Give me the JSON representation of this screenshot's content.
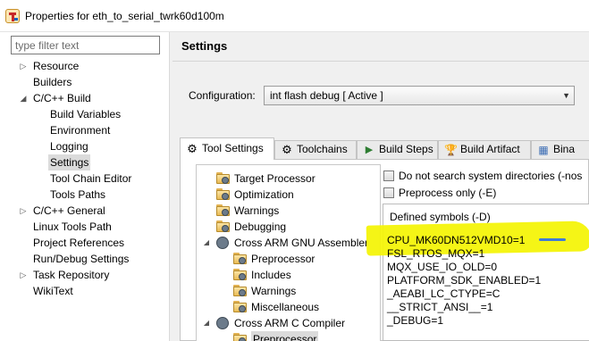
{
  "window": {
    "title": "Properties for eth_to_serial_twrk60d100m",
    "icon": "properties-icon"
  },
  "filter": {
    "placeholder": "type filter text",
    "value": ""
  },
  "nav_tree": [
    {
      "label": "Resource",
      "toggle": "▷"
    },
    {
      "label": "Builders",
      "toggle": ""
    },
    {
      "label": "C/C++ Build",
      "toggle": "◢"
    },
    {
      "label": "Build Variables",
      "toggle": ""
    },
    {
      "label": "Environment",
      "toggle": ""
    },
    {
      "label": "Logging",
      "toggle": ""
    },
    {
      "label": "Settings",
      "toggle": "",
      "selected": true
    },
    {
      "label": "Tool Chain Editor",
      "toggle": ""
    },
    {
      "label": "Tools Paths",
      "toggle": ""
    },
    {
      "label": "C/C++ General",
      "toggle": "▷"
    },
    {
      "label": "Linux Tools Path",
      "toggle": ""
    },
    {
      "label": "Project References",
      "toggle": ""
    },
    {
      "label": "Run/Debug Settings",
      "toggle": ""
    },
    {
      "label": "Task Repository",
      "toggle": "▷"
    },
    {
      "label": "WikiText",
      "toggle": ""
    }
  ],
  "settings": {
    "title": "Settings",
    "configuration_label": "Configuration:",
    "configuration_value": "int flash debug  [ Active ]"
  },
  "tabs": [
    {
      "label": "Tool Settings",
      "icon": "gear-icon",
      "glyph": "⚙",
      "active": true
    },
    {
      "label": "Toolchains",
      "icon": "toolchains-icon",
      "glyph": "⚙"
    },
    {
      "label": "Build Steps",
      "icon": "build-steps-icon",
      "glyph": "▶"
    },
    {
      "label": "Build Artifact",
      "icon": "artifact-icon",
      "glyph": "🏆"
    },
    {
      "label": "Bina",
      "icon": "binary-icon",
      "glyph": "▦"
    }
  ],
  "tool_tree": [
    {
      "label": "Target Processor",
      "level": 1,
      "toggle": ""
    },
    {
      "label": "Optimization",
      "level": 1,
      "toggle": ""
    },
    {
      "label": "Warnings",
      "level": 1,
      "toggle": ""
    },
    {
      "label": "Debugging",
      "level": 1,
      "toggle": ""
    },
    {
      "label": "Cross ARM GNU Assembler",
      "level": 0,
      "toggle": "◢"
    },
    {
      "label": "Preprocessor",
      "level": 2,
      "toggle": ""
    },
    {
      "label": "Includes",
      "level": 2,
      "toggle": ""
    },
    {
      "label": "Warnings",
      "level": 2,
      "toggle": ""
    },
    {
      "label": "Miscellaneous",
      "level": 2,
      "toggle": ""
    },
    {
      "label": "Cross ARM C Compiler",
      "level": 0,
      "toggle": "◢"
    },
    {
      "label": "Preprocessor",
      "level": 2,
      "toggle": ""
    }
  ],
  "options": {
    "no_system_dirs_label": "Do not search system directories (-nos",
    "no_system_dirs_checked": false,
    "preprocess_only_label": "Preprocess only (-E)",
    "preprocess_only_checked": false
  },
  "defined_symbols": {
    "header": "Defined symbols (-D)",
    "items": [
      "CPU_MK60DN512VMD10=1",
      "FSL_RTOS_MQX=1",
      "MQX_USE_IO_OLD=0",
      "PLATFORM_SDK_ENABLED=1",
      "_AEABI_LC_CTYPE=C",
      "__STRICT_ANSI__=1",
      "_DEBUG=1"
    ],
    "highlight_color": "#f4f40a"
  }
}
